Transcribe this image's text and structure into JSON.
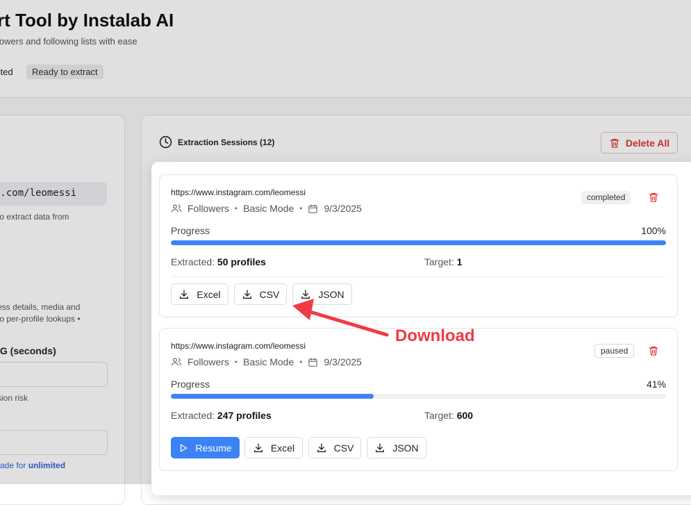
{
  "header": {
    "title": "rt Tool by Instalab AI",
    "subtitle": "lowers and following lists with ease",
    "badge_status": "cted",
    "badge_ready": "Ready to extract"
  },
  "left_panel": {
    "url_value": "m.com/leomessi",
    "url_help": "to extract data from",
    "details_line1": "ess details, media and",
    "details_line2": "to per-profile lookups •",
    "delay_label": "IG (seconds)",
    "risk_text": "sion risk",
    "upgrade_prefix": "rade for ",
    "upgrade_bold": "unlimited"
  },
  "sessions_panel": {
    "title": "Extraction Sessions (12)",
    "delete_all_label": "Delete All"
  },
  "sessions": [
    {
      "url": "https://www.instagram.com/leomessi",
      "type": "Followers",
      "mode": "Basic Mode",
      "date": "9/3/2025",
      "status": "completed",
      "progress_label": "Progress",
      "progress_pct": "100%",
      "progress_value": 1.0,
      "extracted_label": "Extracted:",
      "extracted_value": "50 profiles",
      "target_label": "Target:",
      "target_value": "1",
      "buttons": [
        "Excel",
        "CSV",
        "JSON"
      ]
    },
    {
      "url": "https://www.instagram.com/leomessi",
      "type": "Followers",
      "mode": "Basic Mode",
      "date": "9/3/2025",
      "status": "paused",
      "progress_label": "Progress",
      "progress_pct": "41%",
      "progress_value": 0.41,
      "extracted_label": "Extracted:",
      "extracted_value": "247 profiles",
      "target_label": "Target:",
      "target_value": "600",
      "resume_label": "Resume",
      "buttons": [
        "Excel",
        "CSV",
        "JSON"
      ]
    }
  ],
  "annotation": {
    "label": "Download",
    "color": "#ef3b45"
  },
  "colors": {
    "accent": "#3b82f6",
    "danger": "#e3342f"
  }
}
